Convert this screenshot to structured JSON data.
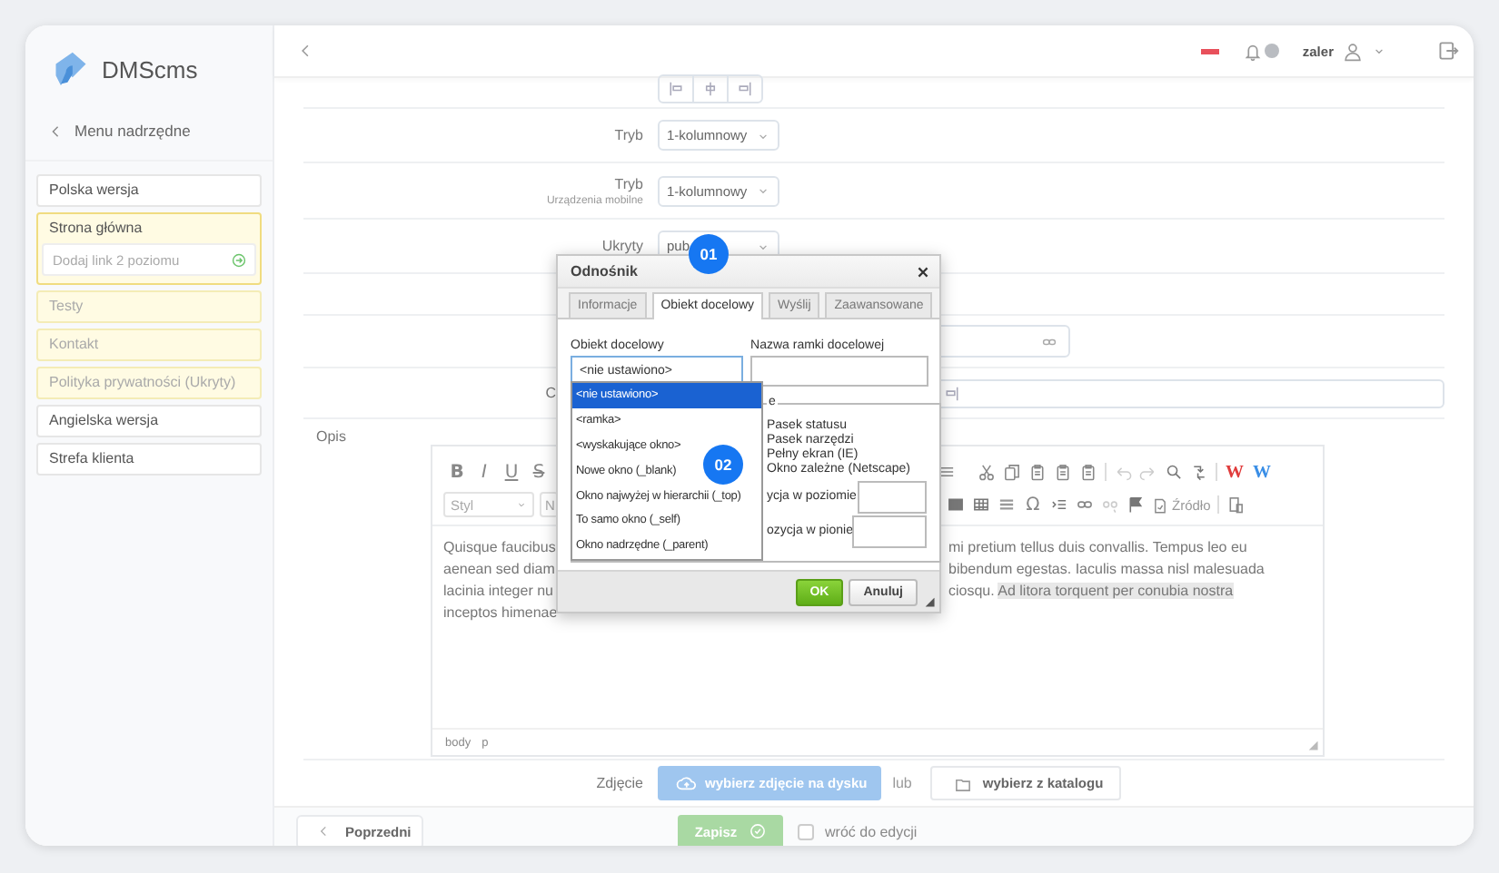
{
  "sidebar": {
    "logo_text": "DMScms",
    "back_label": "Menu nadrzędne",
    "items": [
      {
        "label": "Polska wersja",
        "kind": "lang",
        "selected": false
      },
      {
        "label": "Strona główna",
        "kind": "page",
        "selected": true,
        "expanded": true,
        "add_placeholder": "Dodaj link 2 poziomu"
      },
      {
        "label": "Testy",
        "kind": "page",
        "selected": false
      },
      {
        "label": "Kontakt",
        "kind": "page",
        "selected": false
      },
      {
        "label": "Polityka prywatności (Ukryty)",
        "kind": "page",
        "selected": false
      },
      {
        "label": "Angielska wersja",
        "kind": "lang",
        "selected": false
      },
      {
        "label": "Strefa klienta",
        "kind": "lang",
        "selected": false
      }
    ]
  },
  "topbar": {
    "username": "zaler"
  },
  "form": {
    "rows": [
      {
        "kind": "align"
      },
      {
        "kind": "select",
        "label": "Tryb",
        "value": "1-kolumnowy"
      },
      {
        "kind": "select",
        "label": "Tryb",
        "sublabel": "Urządzenia mobilne",
        "value": "1-kolumnowy"
      },
      {
        "kind": "select",
        "label": "Ukryty",
        "value": "pub"
      },
      {
        "kind": "blank"
      },
      {
        "kind": "link"
      },
      {
        "kind": "align-fragment",
        "label": "C"
      }
    ]
  },
  "editor": {
    "label": "Opis",
    "toolbar": {
      "format_buttons": [
        {
          "label": "B",
          "kind": "bold"
        },
        {
          "label": "I",
          "kind": "italic"
        },
        {
          "label": "U",
          "kind": "underline"
        },
        {
          "label": "S",
          "kind": "strike"
        }
      ],
      "special_char": "Ω",
      "word_buttons": [
        {
          "label": "W",
          "color": "#e03c3c"
        },
        {
          "label": "W",
          "color": "#3a8ee6"
        }
      ],
      "source_button": "Źródło",
      "style_select": "Styl",
      "format_select": "N"
    },
    "left_lines": [
      "Quisque faucibus",
      "aenean sed diam",
      "lacinia integer nu",
      "inceptos himenae"
    ],
    "right_lines": [
      [
        {
          "text": "mi pretium tellus duis convallis. Tempus leo eu",
          "highlighted": false
        }
      ],
      [
        {
          "text": "bibendum egestas. Iaculis massa nisl malesuada",
          "highlighted": false
        }
      ],
      [
        {
          "text": "ciosqu.",
          "highlighted": false
        },
        {
          "text": "Ad litora torquent per conubia nostra",
          "highlighted": true
        }
      ]
    ],
    "path": [
      "body",
      "p"
    ]
  },
  "photo": {
    "label": "Zdjęcie",
    "upload_button": "wybierz zdjęcie na dysku",
    "or": "lub",
    "catalog_button": "wybierz z katalogu"
  },
  "footer": {
    "prev_button": "Poprzedni",
    "save_button": "Zapisz",
    "return_checkbox": {
      "label": "wróć do edycji",
      "checked": false
    }
  },
  "dialog": {
    "title": "Odnośnik",
    "tabs": [
      {
        "label": "Informacje",
        "selected": false
      },
      {
        "label": "Obiekt docelowy",
        "selected": true
      },
      {
        "label": "Wyślij",
        "selected": false
      },
      {
        "label": "Zaawansowane",
        "selected": false
      }
    ],
    "target_label": "Obiekt docelowy",
    "target_value": "<nie ustawiono>",
    "frame_label": "Nazwa ramki docelowej",
    "dropdown": [
      {
        "label": "<nie ustawiono>",
        "selected": true
      },
      {
        "label": "<ramka>",
        "selected": false
      },
      {
        "label": "<wyskakujące okno>",
        "selected": false
      },
      {
        "label": "Nowe okno (_blank)",
        "selected": false
      },
      {
        "label": "Okno najwyżej w hierarchii (_top)",
        "selected": false
      },
      {
        "label": "To samo okno (_self)",
        "selected": false
      },
      {
        "label": "Okno nadrzędne (_parent)",
        "selected": false
      }
    ],
    "legend": "e",
    "options": [
      "Pasek statusu",
      "Pasek narzędzi",
      "Pełny ekran (IE)",
      "Okno zależne (Netscape)"
    ],
    "positions": [
      "ycja w poziomie",
      "ozycja w pionie"
    ],
    "ok_button": "OK",
    "cancel_button": "Anuluj"
  },
  "badges": [
    "01",
    "02"
  ]
}
